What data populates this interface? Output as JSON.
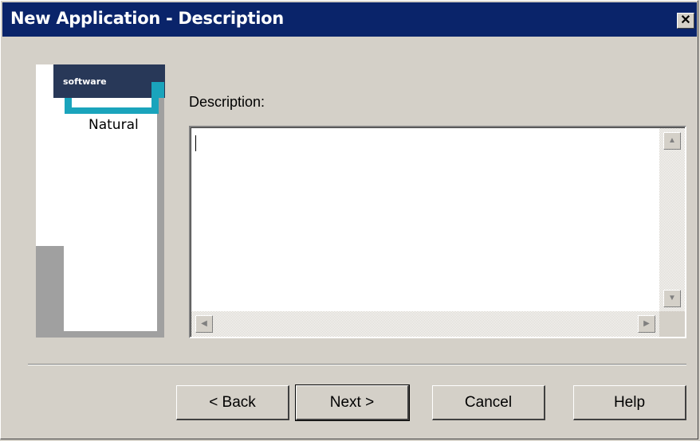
{
  "window": {
    "title": "New Application - Description",
    "close_glyph": "✕"
  },
  "banner": {
    "logo_text": "software",
    "product": "Natural"
  },
  "form": {
    "description_label": "Description:",
    "description_value": ""
  },
  "scrollbar": {
    "up": "▲",
    "down": "▼",
    "left": "◀",
    "right": "▶"
  },
  "buttons": {
    "back": "< Back",
    "next": "Next >",
    "cancel": "Cancel",
    "help": "Help"
  },
  "colors": {
    "titlebar": "#0a246a",
    "dialog_bg": "#d4d0c8",
    "accent_teal": "#1aa4bc"
  }
}
